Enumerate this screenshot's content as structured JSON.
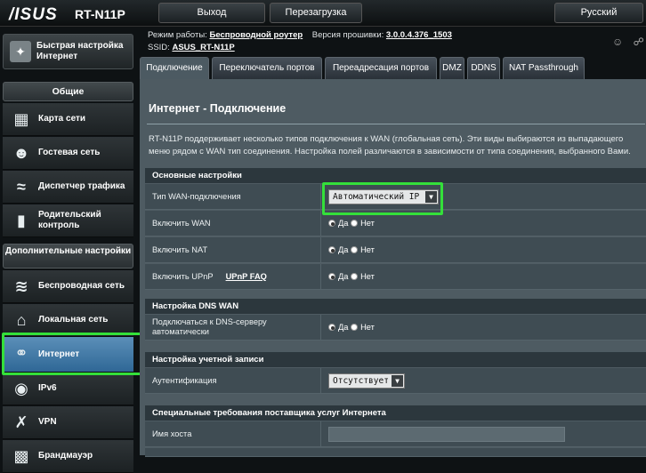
{
  "header": {
    "brand": "/ISUS",
    "model": "RT-N11P",
    "logout": "Выход",
    "reboot": "Перезагрузка",
    "language": "Русский"
  },
  "status": {
    "mode_label": "Режим работы:",
    "mode_value": "Беспроводной роутер",
    "fw_label": "Версия прошивки:",
    "fw_value": "3.0.0.4.376_1503",
    "ssid_label": "SSID:",
    "ssid_value": "ASUS_RT-N11P"
  },
  "sidebar": {
    "quick_setup": "Быстрая настройка Интернет",
    "general_header": "Общие",
    "general": [
      {
        "label": "Карта сети",
        "icon": "network-map-icon"
      },
      {
        "label": "Гостевая сеть",
        "icon": "guest-network-icon"
      },
      {
        "label": "Диспетчер трафика",
        "icon": "traffic-manager-icon"
      },
      {
        "label": "Родительский контроль",
        "icon": "parental-control-icon"
      }
    ],
    "advanced_header": "Дополнительные настройки",
    "advanced": [
      {
        "label": "Беспроводная сеть",
        "icon": "wifi-icon"
      },
      {
        "label": "Локальная сеть",
        "icon": "home-icon"
      },
      {
        "label": "Интернет",
        "icon": "globe-icon"
      },
      {
        "label": "IPv6",
        "icon": "ipv6-icon"
      },
      {
        "label": "VPN",
        "icon": "vpn-icon"
      },
      {
        "label": "Брандмауэр",
        "icon": "firewall-icon"
      }
    ]
  },
  "tabs": [
    "Подключение",
    "Переключатель портов",
    "Переадресация портов",
    "DMZ",
    "DDNS",
    "NAT Passthrough"
  ],
  "page": {
    "title": "Интернет - Подключение",
    "description": "RT-N11P поддерживает несколько типов подключения к WAN (глобальная сеть). Эти виды выбираются из выпадающего меню рядом с WAN тип соединения. Настройка полей различаются в зависимости от типа соединения, выбранного Вами.",
    "basic_header": "Основные настройки",
    "wan_type_label": "Тип WAN-подключения",
    "wan_type_value": "Автоматический IP",
    "enable_wan_label": "Включить WAN",
    "enable_nat_label": "Включить NAT",
    "enable_upnp_label": "Включить UPnP",
    "upnp_faq": "UPnP FAQ",
    "yes": "Да",
    "no": "Нет",
    "dns_header": "Настройка DNS WAN",
    "dns_auto_label": "Подключаться к DNS-серверу автоматически",
    "account_header": "Настройка учетной записи",
    "auth_label": "Аутентификация",
    "auth_value": "Отсутствует",
    "isp_header": "Специальные требования поставщика услуг Интернета",
    "hostname_label": "Имя хоста"
  },
  "colors": {
    "highlight": "#34e03a",
    "active_nav": "#3f77a6"
  }
}
